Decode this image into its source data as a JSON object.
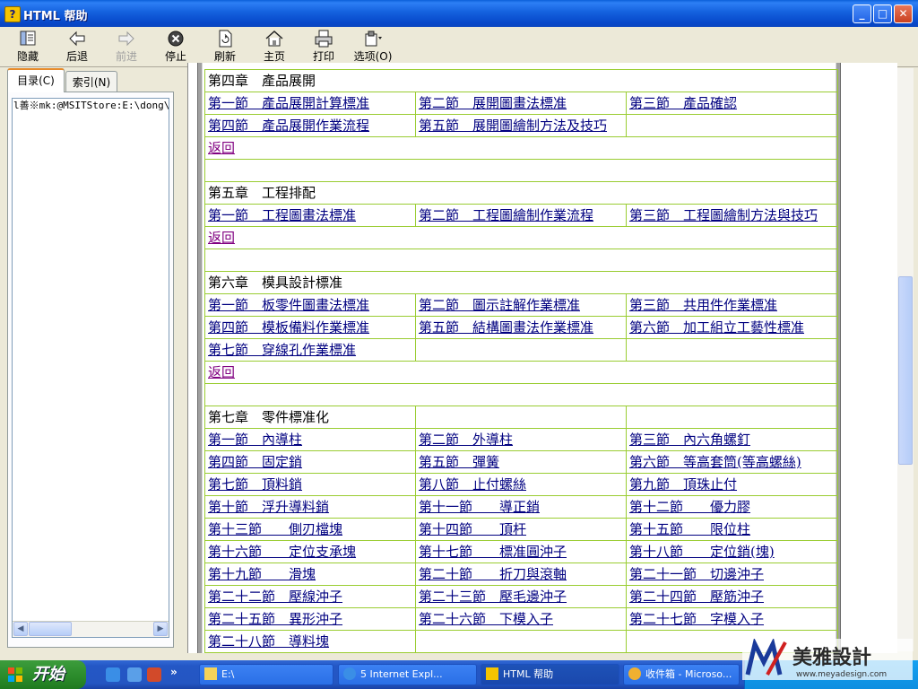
{
  "window": {
    "title": "HTML 帮助"
  },
  "toolbar": {
    "hide": "隐藏",
    "back": "后退",
    "forward": "前进",
    "stop": "停止",
    "refresh": "刷新",
    "home": "主页",
    "print": "打印",
    "options": "选项(O)"
  },
  "nav": {
    "tab_contents": "目录(C)",
    "tab_index": "索引(N)",
    "tree_item": "l善※mk:@MSITStore:E:\\dong\\快|"
  },
  "chapters": [
    {
      "title": "第四章　產品展開",
      "rows": [
        [
          "第一節　產品展開計算標准",
          "第二節　展開圖畫法標准",
          "第三節　產品確認"
        ],
        [
          "第四節　產品展開作業流程",
          "第五節　展開圖繪制方法及技巧",
          ""
        ]
      ],
      "back": "返回"
    },
    {
      "title": "第五章　工程排配",
      "rows": [
        [
          "第一節　工程圖畫法標准",
          "第二節　工程圖繪制作業流程",
          "第三節　工程圖繪制方法與技巧"
        ]
      ],
      "back": "返回"
    },
    {
      "title": "第六章　模具設計標准",
      "rows": [
        [
          "第一節　板零件圖畫法標准",
          "第二節　圖示註解作業標准",
          "第三節　共用件作業標准"
        ],
        [
          "第四節　模板備料作業標准",
          "第五節　結構圖畫法作業標准",
          "第六節　加工組立工藝性標准"
        ],
        [
          "第七節　穿線孔作業標准",
          "",
          ""
        ]
      ],
      "back": "返回"
    },
    {
      "title": "第七章　零件標准化",
      "rows": [
        [
          "第一節　內導柱",
          "第二節　外導柱",
          "第三節　內六角螺釘"
        ],
        [
          "第四節　固定銷",
          "第五節　彈簧",
          "第六節　等高套筒(等高螺絲)"
        ],
        [
          "第七節　頂料銷",
          "第八節　止付螺絲",
          "第九節　頂珠止付"
        ],
        [
          "第十節　浮升導料銷",
          "第十一節　　導正銷",
          "第十二節　　優力膠"
        ],
        [
          "第十三節　　側刃檔塊",
          "第十四節　　頂杆",
          "第十五節　　限位柱"
        ],
        [
          "第十六節　　定位支承塊",
          "第十七節　　標准圓沖子",
          "第十八節　　定位銷(塊)"
        ],
        [
          "第十九節　　滑塊",
          "第二十節　　折刀與滾軸",
          "第二十一節　切邊沖子"
        ],
        [
          "第二十二節　壓線沖子",
          "第二十三節　壓毛邊沖子",
          "第二十四節　壓筋沖子"
        ],
        [
          "第二十五節　異形沖子",
          "第二十六節　下模入子",
          "第二十七節　字模入子"
        ],
        [
          "第二十八節　導料塊",
          "",
          ""
        ]
      ]
    }
  ],
  "taskbar": {
    "start": "开始",
    "items": [
      {
        "label": "E:\\"
      },
      {
        "label": "5 Internet Expl..."
      },
      {
        "label": "HTML 帮助"
      },
      {
        "label": "收件箱 - Microso..."
      }
    ]
  },
  "watermark": {
    "brand": "美雅設計",
    "url": "www.meyadesign.com"
  },
  "colors": {
    "link": "#000080",
    "visited": "#800080",
    "grid": "#9acd32",
    "titlebar": "#0a46bf"
  }
}
